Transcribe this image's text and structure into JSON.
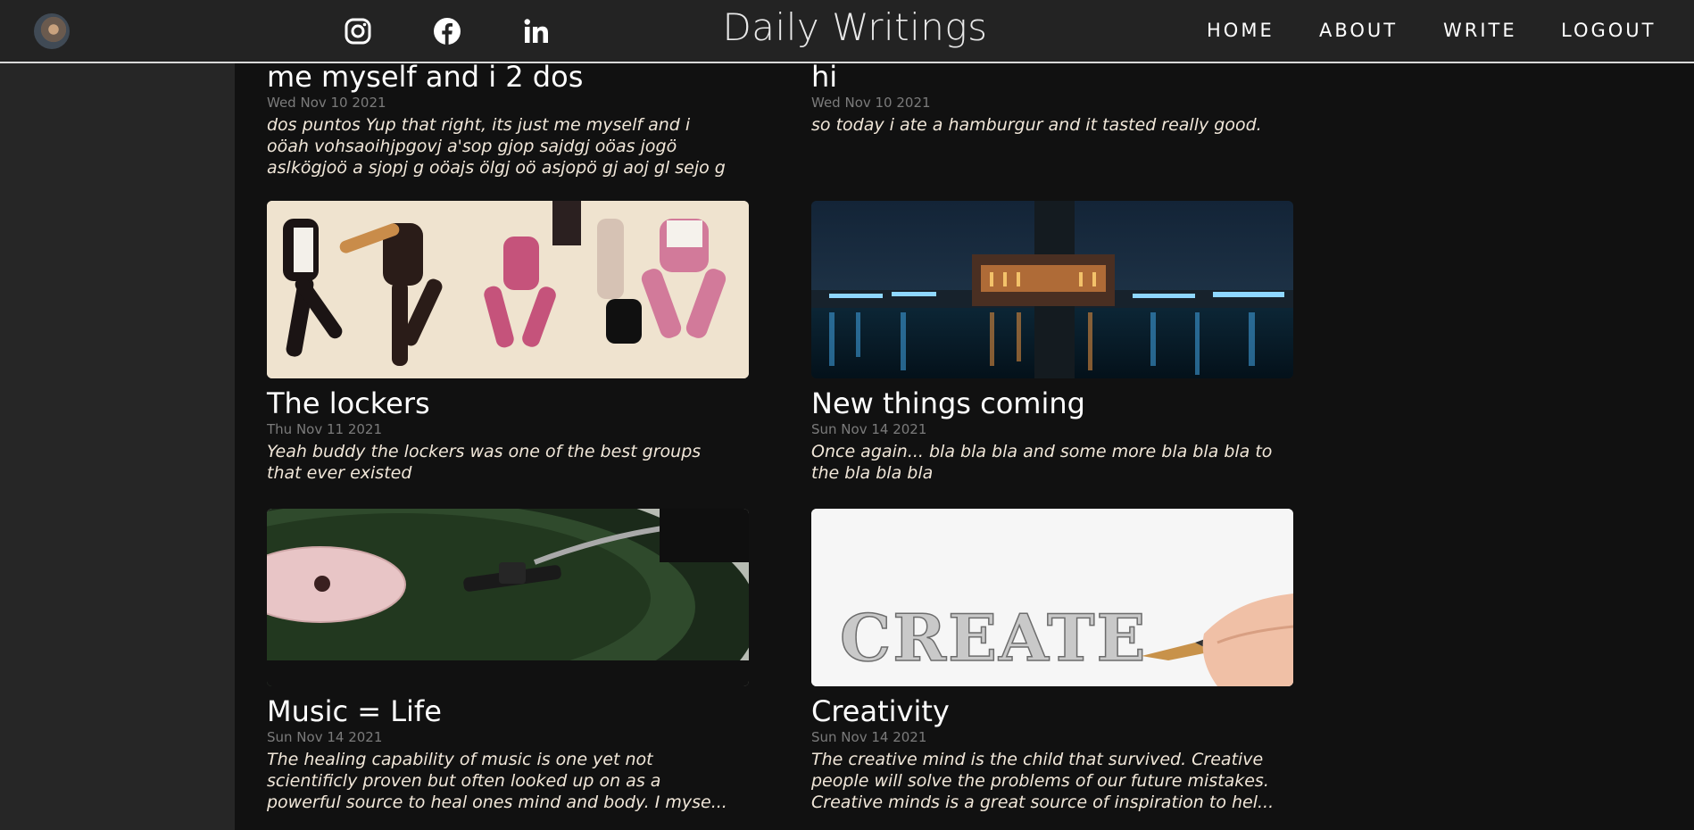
{
  "header": {
    "brand": "Daily Writings",
    "nav": {
      "home": "HOME",
      "about": "ABOUT",
      "write": "WRITE",
      "logout": "LOGOUT"
    },
    "social_icons": [
      "instagram-icon",
      "facebook-icon",
      "linkedin-icon"
    ]
  },
  "colors": {
    "topbar_bg": "#232323",
    "page_bg": "#111111",
    "side_bg": "#262626",
    "excerpt_text": "#f1e7d9",
    "date_text": "#7b7b7b"
  },
  "posts": [
    {
      "title": "me myself and i 2 dos",
      "date": "Wed Nov 10 2021",
      "desc": "dos puntos Yup that right, its just me myself and i oöah vohsaoihjpgovj a'sop gjop sajdgj oöas jogö aslkögjoö a sjopj g oöajs ölgj oö asjopö gj aoj gl sejo g"
    },
    {
      "title": "hi",
      "date": "Wed Nov 10 2021",
      "desc": "so today i ate a hamburgur and it tasted really good."
    },
    {
      "title": "The lockers",
      "date": "Thu Nov 11 2021",
      "desc": "Yeah buddy the lockers was one of the best groups that ever existed",
      "image": "dancers"
    },
    {
      "title": "New things coming",
      "date": "Sun Nov 14 2021",
      "desc": "Once again... bla bla bla and some more bla bla bla to the bla bla bla",
      "image": "city-at-night"
    },
    {
      "title": "Music = Life",
      "date": "Sun Nov 14 2021",
      "desc": "The healing capability of music is one yet not scientificly proven but often looked up on as a powerful source to heal ones mind and body. I myse...",
      "image": "vinyl-record-player"
    },
    {
      "title": "Creativity",
      "date": "Sun Nov 14 2021",
      "desc": "The creative mind is the child that survived. Creative people will solve the problems of our future mistakes. Creative minds is a great source of inspiration to hel...",
      "image": "create-pencil",
      "image_text": "CREATE"
    }
  ]
}
